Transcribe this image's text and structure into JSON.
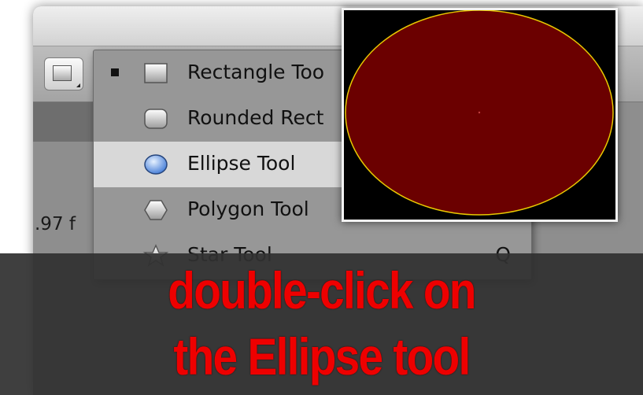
{
  "toolbar": {
    "shape_button_icon": "rectangle-tool-icon",
    "frame_rate_text": ".97 f"
  },
  "shape_menu": {
    "items": [
      {
        "label": "Rectangle Too",
        "icon": "rectangle-icon",
        "checked": true,
        "highlighted": false,
        "shortcut": ""
      },
      {
        "label": "Rounded Rect",
        "icon": "rounded-rectangle-icon",
        "checked": false,
        "highlighted": false,
        "shortcut": ""
      },
      {
        "label": "Ellipse Tool",
        "icon": "ellipse-icon",
        "checked": false,
        "highlighted": true,
        "shortcut": ""
      },
      {
        "label": "Polygon Tool",
        "icon": "polygon-icon",
        "checked": false,
        "highlighted": false,
        "shortcut": ""
      },
      {
        "label": "Star Tool",
        "icon": "star-icon",
        "checked": false,
        "highlighted": false,
        "shortcut": "Q"
      }
    ]
  },
  "ellipse_preview": {
    "background_color": "#000000",
    "fill_color": "#6b0000",
    "stroke_color": "#e8c800"
  },
  "caption": {
    "line1": "double-click on",
    "line2": "the Ellipse tool",
    "color": "#ee0000"
  }
}
